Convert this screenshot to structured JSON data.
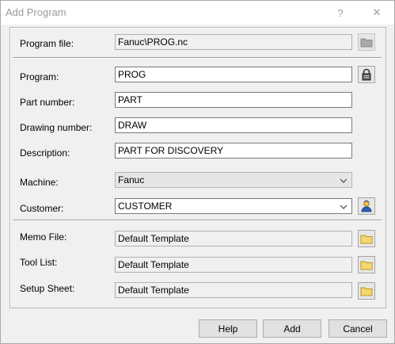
{
  "dialog": {
    "title": "Add Program",
    "help_glyph": "?",
    "close_glyph": "✕"
  },
  "fields": {
    "program_file": {
      "label": "Program file:",
      "value": "Fanuc\\PROG.nc"
    },
    "program": {
      "label": "Program:",
      "value": "PROG"
    },
    "part_number": {
      "label": "Part number:",
      "value": "PART"
    },
    "drawing_number": {
      "label": "Drawing number:",
      "value": "DRAW"
    },
    "description": {
      "label": "Description:",
      "value": "PART FOR DISCOVERY"
    },
    "machine": {
      "label": "Machine:",
      "value": "Fanuc"
    },
    "customer": {
      "label": "Customer:",
      "value": "CUSTOMER"
    },
    "memo_file": {
      "label": "Memo File:",
      "value": "Default Template"
    },
    "tool_list": {
      "label": "Tool List:",
      "value": "Default Template"
    },
    "setup_sheet": {
      "label": "Setup Sheet:",
      "value": "Default Template"
    }
  },
  "icons": {
    "folder": "folder-icon",
    "lock": "lock-icon",
    "customer": "customer-icon",
    "dropdown": "chevron-down-icon"
  },
  "buttons": {
    "help": "Help",
    "add": "Add",
    "cancel": "Cancel"
  },
  "colors": {
    "folder_yellow": "#f5d76e",
    "folder_disabled": "#a9a9a9"
  }
}
